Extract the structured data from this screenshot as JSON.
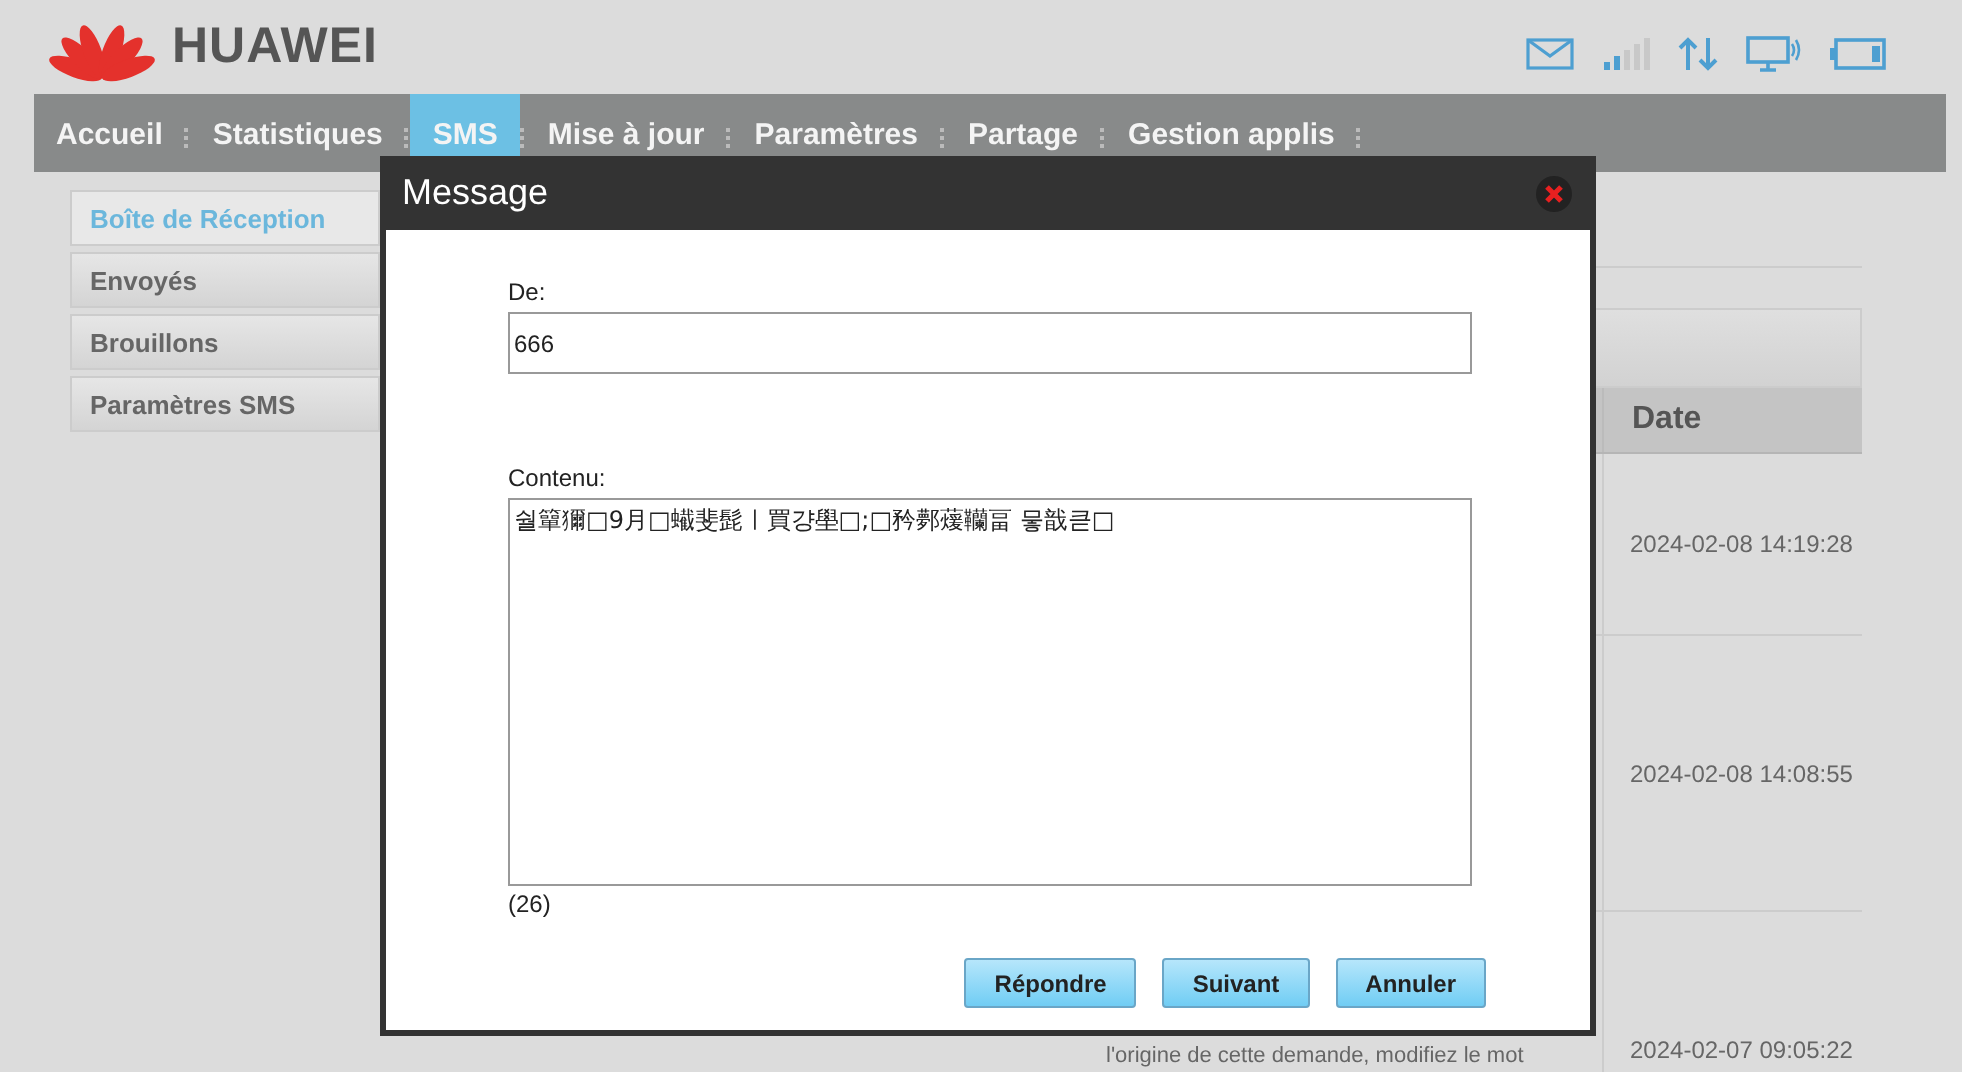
{
  "logo": {
    "text": "HUAWEI"
  },
  "nav": [
    {
      "label": "Accueil",
      "selected": false
    },
    {
      "label": "Statistiques",
      "selected": false
    },
    {
      "label": "SMS",
      "selected": true
    },
    {
      "label": "Mise à jour",
      "selected": false
    },
    {
      "label": "Paramètres",
      "selected": false
    },
    {
      "label": "Partage",
      "selected": false
    },
    {
      "label": "Gestion applis",
      "selected": false
    }
  ],
  "sidebar": [
    {
      "label": "Boîte de Réception",
      "selected": true
    },
    {
      "label": "Envoyés",
      "selected": false
    },
    {
      "label": "Brouillons",
      "selected": false
    },
    {
      "label": "Paramètres SMS",
      "selected": false
    }
  ],
  "table": {
    "columns": [
      "Date"
    ],
    "rows": [
      {
        "date": "2024-02-08 14:19:28"
      },
      {
        "date": "2024-02-08 14:08:55"
      },
      {
        "date": "2024-02-07 09:05:22",
        "text": "l'origine de cette demande, modifiez le mot"
      }
    ]
  },
  "dialog": {
    "title": "Message",
    "from_label": "De:",
    "from_value": "666",
    "content_label": "Contenu:",
    "content_value": "숼簞獮□9月□蠘斐髭ㅣ買걍壆□;□矜鄸蕿韊畐 뭏戠큳□",
    "count": "(26)",
    "buttons": [
      "Répondre",
      "Suivant",
      "Annuler"
    ]
  }
}
